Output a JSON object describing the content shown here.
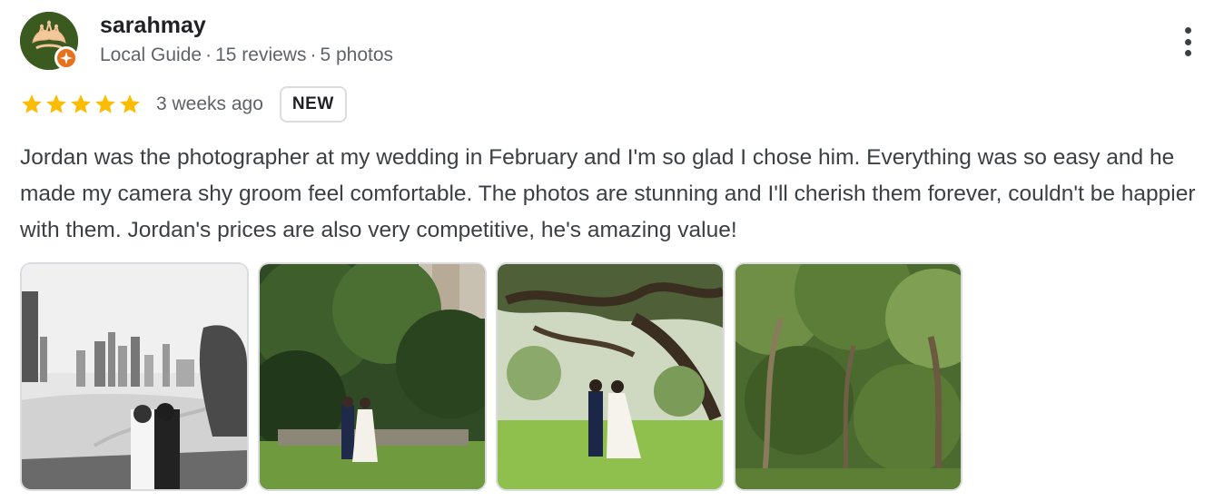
{
  "reviewer": {
    "name": "sarahmay",
    "role": "Local Guide",
    "separator": "·",
    "reviews": "15 reviews",
    "photos": "5 photos",
    "avatar_icon": "crown-icon",
    "badge_icon": "local-guide-star-icon"
  },
  "rating": {
    "stars": 5,
    "max": 5,
    "time_ago": "3 weeks ago",
    "badge": "NEW",
    "star_color": "#fbbc04"
  },
  "review": {
    "text": "Jordan was the photographer at my wedding in February and I'm so glad I chose him. Everything was so easy and he made my camera shy groom feel comfortable. The photos are stunning and I'll cherish them forever, couldn't be happier with them. Jordan's prices are also very competitive, he's amazing value!"
  },
  "menu": {
    "icon": "more-vert-icon"
  },
  "colors": {
    "accent": "#e8711c",
    "avatar_bg": "#3b5a1f"
  }
}
